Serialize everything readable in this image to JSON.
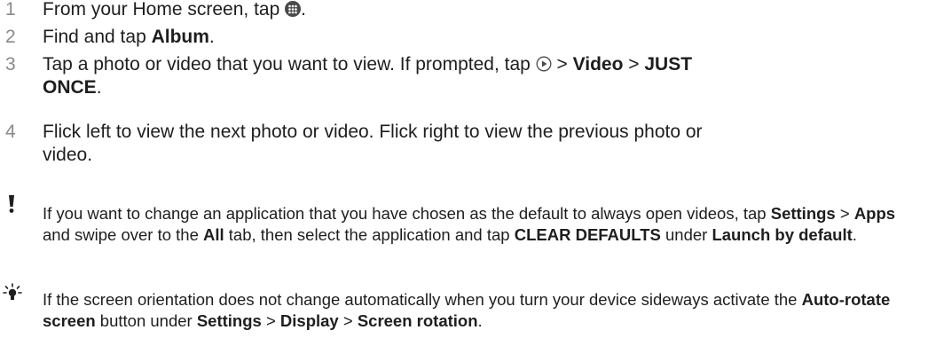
{
  "steps": [
    {
      "num": "1",
      "a": "From your Home screen, tap ",
      "b": "."
    },
    {
      "num": "2",
      "a": "Find and tap ",
      "bold1": "Album",
      "b": "."
    },
    {
      "num": "3",
      "a": "Tap a photo or video that you want to view. If prompted, tap ",
      "b": " > ",
      "bold1": "Video",
      "c": " > ",
      "bold2": "JUST ONCE",
      "d": "."
    },
    {
      "num": "4",
      "a": "Flick left to view the next photo or video. Flick right to view the previous photo or video."
    }
  ],
  "note1": {
    "t1": "If you want to change an application that you have chosen as the default to always open videos, tap ",
    "b1": "Settings",
    "t2": " > ",
    "b2": "Apps",
    "t3": " and swipe over to the ",
    "b3": "All",
    "t4": " tab, then select the application and tap ",
    "b4": "CLEAR DEFAULTS",
    "t5": " under ",
    "b5": "Launch by default",
    "t6": "."
  },
  "note2": {
    "t1": "If the screen orientation does not change automatically when you turn your device sideways activate the ",
    "b1": "Auto-rotate screen",
    "t2": " button under ",
    "b2": "Settings",
    "t3": " > ",
    "b3": "Display",
    "t4": " > ",
    "b4": "Screen rotation",
    "t5": "."
  },
  "icons": {
    "apps": "apps-grid-icon",
    "play": "play-circle-icon",
    "warning": "exclamation-icon",
    "tip": "lightbulb-icon"
  }
}
